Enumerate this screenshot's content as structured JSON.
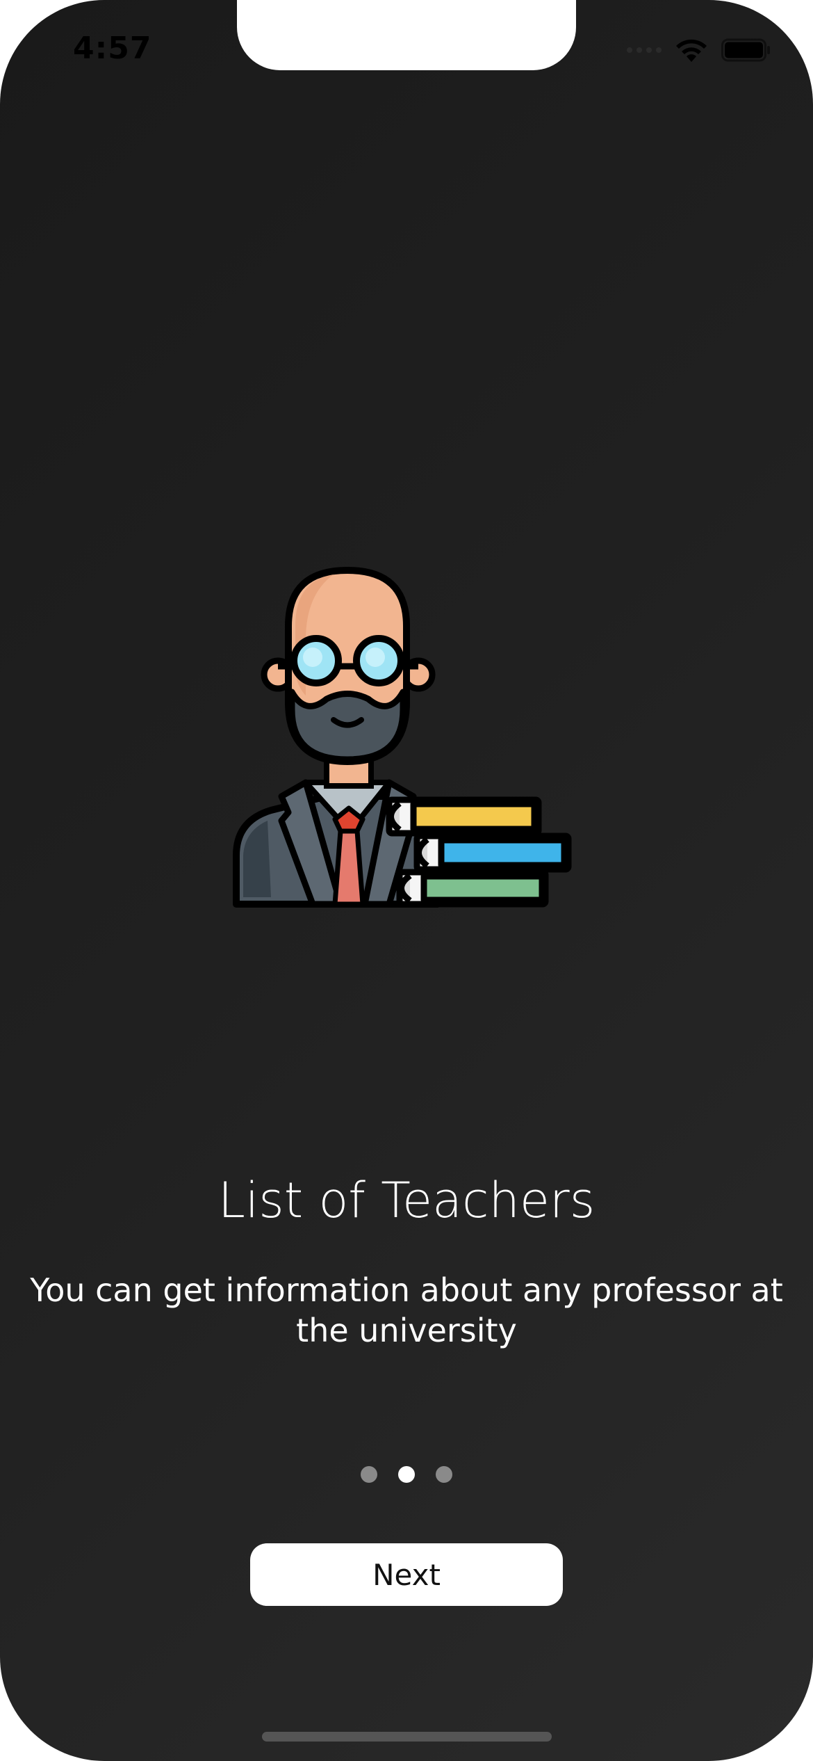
{
  "status_bar": {
    "time": "4:57",
    "icons": [
      "cellular-signal-icon",
      "wifi-icon",
      "battery-icon"
    ]
  },
  "onboarding": {
    "illustration": "teacher-with-books-icon",
    "title": "List of Teachers",
    "description": "You can get information about any professor at the university",
    "page_indicator": {
      "total": 3,
      "current": 2
    },
    "next_label": "Next"
  },
  "colors": {
    "background": "#1f1f1f",
    "text": "#ffffff",
    "button_background": "#ffffff",
    "dot_inactive": "#8a8a8a",
    "dot_active": "#ffffff"
  }
}
